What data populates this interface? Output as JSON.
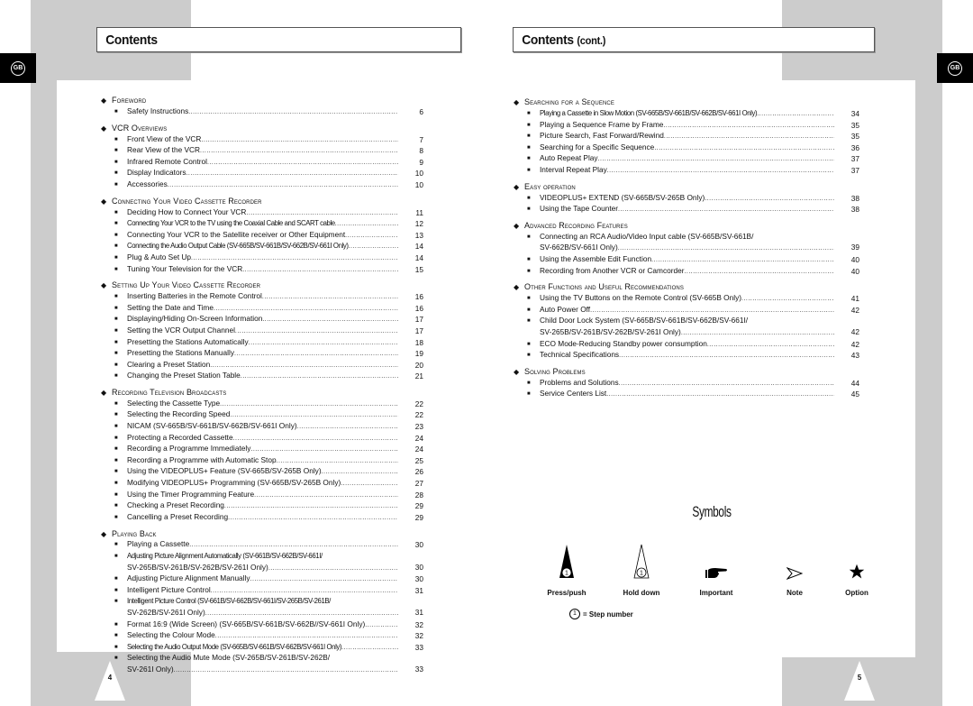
{
  "left_page": {
    "title": "Contents",
    "lang_badge": "GB",
    "page_number": "4",
    "sections": [
      {
        "heading": "Foreword",
        "items": [
          {
            "label": "Safety Instructions",
            "page": "6"
          }
        ]
      },
      {
        "heading": "VCR Overviews",
        "items": [
          {
            "label": "Front View of the VCR",
            "page": "7"
          },
          {
            "label": "Rear View of the VCR",
            "page": "8"
          },
          {
            "label": "Infrared Remote Control",
            "page": "9"
          },
          {
            "label": "Display Indicators",
            "page": "10"
          },
          {
            "label": "Accessories",
            "page": "10"
          }
        ]
      },
      {
        "heading": "Connecting Your Video Cassette Recorder",
        "items": [
          {
            "label": "Deciding How to Connect Your VCR",
            "page": "11"
          },
          {
            "label": "Connecting Your VCR to the TV using the Coaxial Cable and SCART cable",
            "page": "12"
          },
          {
            "label": "Connecting Your VCR to the Satellite receiver or Other Equipment",
            "page": "13"
          },
          {
            "label": "Connecting the Audio Output Cable (SV-665B/SV-661B/SV-662B/SV-661I Only)",
            "page": "14"
          },
          {
            "label": "Plug & Auto Set Up",
            "page": "14"
          },
          {
            "label": "Tuning Your Television for the VCR",
            "page": "15"
          }
        ]
      },
      {
        "heading": "Setting Up Your Video Cassette Recorder",
        "items": [
          {
            "label": "Inserting Batteries in the Remote Control",
            "page": "16"
          },
          {
            "label": "Setting the Date and Time",
            "page": "16"
          },
          {
            "label": "Displaying/Hiding On-Screen Information",
            "page": "17"
          },
          {
            "label": "Setting the VCR Output Channel",
            "page": "17"
          },
          {
            "label": "Presetting the Stations Automatically",
            "page": "18"
          },
          {
            "label": "Presetting the Stations Manually",
            "page": "19"
          },
          {
            "label": "Clearing a Preset Station",
            "page": "20"
          },
          {
            "label": "Changing the Preset Station Table",
            "page": "21"
          }
        ]
      },
      {
        "heading": "Recording Television Broadcasts",
        "items": [
          {
            "label": "Selecting the Cassette Type",
            "page": "22"
          },
          {
            "label": "Selecting the Recording Speed",
            "page": "22"
          },
          {
            "label": "NICAM (SV-665B/SV-661B/SV-662B/SV-661I Only)",
            "page": "23"
          },
          {
            "label": "Protecting a Recorded Cassette",
            "page": "24"
          },
          {
            "label": "Recording a Programme Immediately",
            "page": "24"
          },
          {
            "label": "Recording a Programme with Automatic Stop",
            "page": "25"
          },
          {
            "label": "Using the VIDEOPLUS+ Feature (SV-665B/SV-265B Only)",
            "page": "26"
          },
          {
            "label": "Modifying VIDEOPLUS+ Programming (SV-665B/SV-265B Only)",
            "page": "27"
          },
          {
            "label": "Using the Timer Programming Feature",
            "page": "28"
          },
          {
            "label": "Checking a Preset Recording",
            "page": "29"
          },
          {
            "label": "Cancelling a Preset Recording",
            "page": "29"
          }
        ]
      },
      {
        "heading": "Playing Back",
        "items": [
          {
            "label": "Playing a Cassette",
            "page": "30"
          },
          {
            "label": "Adjusting Picture Alignment Automatically (SV-661B/SV-662B/SV-661I/",
            "label2": "SV-265B/SV-261B/SV-262B/SV-261I Only)",
            "page": "30"
          },
          {
            "label": "Adjusting Picture Alignment Manually",
            "page": "30"
          },
          {
            "label": "Intelligent Picture Control",
            "page": "31"
          },
          {
            "label": "Intelligent Picture Control (SV-661B/SV-662B/SV-661I/SV-265B/SV-261B/",
            "label2": "SV-262B/SV-261I Only)",
            "page": "31"
          },
          {
            "label": "Format 16:9 (Wide Screen) (SV-665B/SV-661B/SV-662B//SV-661I Only)",
            "page": "32"
          },
          {
            "label": "Selecting the Colour Mode",
            "page": "32"
          },
          {
            "label": "Selecting the Audio Output Mode (SV-665B/SV-661B/SV-662B/SV-661I Only)",
            "page": "33"
          },
          {
            "label": "Selecting the Audio Mute Mode (SV-265B/SV-261B/SV-262B/",
            "label2": "SV-261I Only)",
            "page": "33"
          }
        ]
      }
    ]
  },
  "right_page": {
    "title": "Contents",
    "title_suffix": "(cont.)",
    "lang_badge": "GB",
    "page_number": "5",
    "sections": [
      {
        "heading": "Searching for a Sequence",
        "items": [
          {
            "label": "Playing a Cassette in Slow Motion (SV-665B/SV-661B/SV-662B/SV-661I Only)",
            "page": "34"
          },
          {
            "label": "Playing a Sequence Frame by Frame",
            "page": "35"
          },
          {
            "label": "Picture Search, Fast Forward/Rewind",
            "page": "35"
          },
          {
            "label": "Searching for a Specific Sequence",
            "page": "36"
          },
          {
            "label": "Auto Repeat Play",
            "page": "37"
          },
          {
            "label": "Interval Repeat Play",
            "page": "37"
          }
        ]
      },
      {
        "heading": "Easy operation",
        "items": [
          {
            "label": "VIDEOPLUS+ EXTEND (SV-665B/SV-265B Only)",
            "page": "38"
          },
          {
            "label": "Using the Tape Counter",
            "page": "38"
          }
        ]
      },
      {
        "heading": "Advanced Recording Features",
        "items": [
          {
            "label": "Connecting an RCA Audio/Video Input cable (SV-665B/SV-661B/",
            "label2": "SV-662B/SV-661I Only)",
            "page": "39"
          },
          {
            "label": "Using the Assemble Edit Function",
            "page": "40"
          },
          {
            "label": "Recording from Another VCR or Camcorder",
            "page": "40"
          }
        ]
      },
      {
        "heading": "Other Functions and Useful Recommendations",
        "items": [
          {
            "label": "Using the TV Buttons on the Remote Control (SV-665B Only)",
            "page": "41"
          },
          {
            "label": "Auto Power Off",
            "page": "42"
          },
          {
            "label": "Child Door Lock System (SV-665B/SV-661B/SV-662B/SV-661I/",
            "label2": "SV-265B/SV-261B/SV-262B/SV-261I Only)",
            "page": "42"
          },
          {
            "label": "ECO Mode-Reducing Standby power consumption",
            "page": "42"
          },
          {
            "label": "Technical Specifications",
            "page": "43"
          }
        ]
      },
      {
        "heading": "Solving Problems",
        "items": [
          {
            "label": "Problems and Solutions",
            "page": "44"
          },
          {
            "label": "Service Centers List",
            "page": "45"
          }
        ]
      }
    ],
    "symbols": {
      "title": "Symbols",
      "items": [
        {
          "icon": "press-push-icon",
          "label": "Press/push"
        },
        {
          "icon": "hold-down-icon",
          "label": "Hold down"
        },
        {
          "icon": "pointing-hand-icon",
          "label": "Important"
        },
        {
          "icon": "arrowhead-icon",
          "label": "Note"
        },
        {
          "icon": "star-icon",
          "label": "Option"
        }
      ],
      "step_number_glyph": "1",
      "step_note": "= Step number"
    }
  }
}
